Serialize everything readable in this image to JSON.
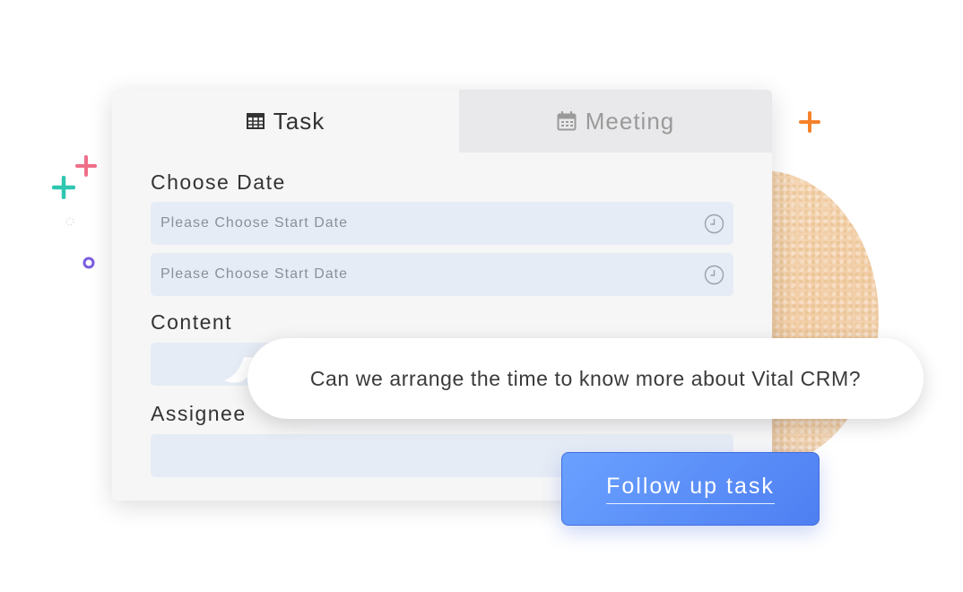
{
  "tabs": [
    {
      "label": "Task",
      "icon": "table-icon",
      "active": true
    },
    {
      "label": "Meeting",
      "icon": "calendar-icon",
      "active": false
    }
  ],
  "form": {
    "date_label": "Choose Date",
    "start_date_placeholder": "Please Choose Start Date",
    "end_date_placeholder": "Please Choose Start Date",
    "content_label": "Content",
    "assignee_label": "Assignee"
  },
  "bubble": {
    "text": "Can we arrange the time to know more about Vital CRM?"
  },
  "button": {
    "label": "Follow up task"
  },
  "colors": {
    "accent": "#5a8cf8",
    "field_bg": "#e6ecf5",
    "plus_pink": "#ef6f8a",
    "plus_teal": "#2fc7b0",
    "plus_orange": "#f5822a",
    "dot_purple": "#7a5ce0"
  }
}
